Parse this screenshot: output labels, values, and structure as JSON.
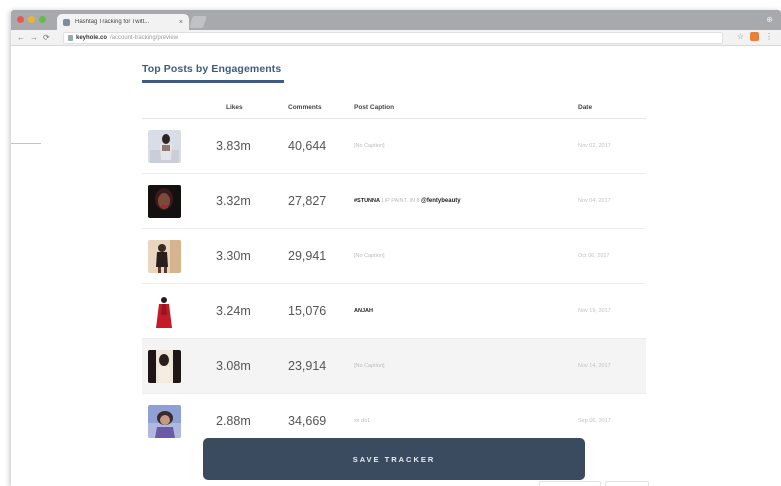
{
  "browser": {
    "tab_title": "Hashtag Tracking for Twitt...",
    "tab_close": "×",
    "url_host": "keyhole.co",
    "url_path": "/account-tracking/preview",
    "nav_back": "←",
    "nav_forward": "→",
    "nav_reload": "⟳",
    "star": "☆",
    "menu": "⋮",
    "profile": "⊕",
    "traffic_light_colors": [
      "#e8584f",
      "#e8b53a",
      "#5fbf4a"
    ]
  },
  "section": {
    "title": "Top Posts by Engagements"
  },
  "table": {
    "columns": [
      "Likes",
      "Comments",
      "Post Caption",
      "Date"
    ],
    "rows": [
      {
        "likes": "3.83m",
        "comments": "40,644",
        "caption": "[No Caption]",
        "date": "Nov 02, 2017",
        "thumb_colors": [
          "#d8dde6",
          "#2a2424"
        ]
      },
      {
        "likes": "3.32m",
        "comments": "27,827",
        "caption_strong": "#STUNNA",
        "caption_soft": " LIP PAINT. IN 8 ",
        "caption_handle": "@fentybeauty",
        "date": "Nov 04, 2017",
        "thumb_colors": [
          "#b4203a",
          "#141010"
        ]
      },
      {
        "likes": "3.30m",
        "comments": "29,941",
        "caption": "[No Caption]",
        "date": "Oct 06, 2017",
        "thumb_colors": [
          "#e9d6c0",
          "#3a2a22"
        ]
      },
      {
        "likes": "3.24m",
        "comments": "15,076",
        "caption_strong": "ANJAH",
        "date": "Nov 19, 2017",
        "thumb_colors": [
          "#ffffff",
          "#c31b28"
        ]
      },
      {
        "likes": "3.08m",
        "comments": "23,914",
        "caption": "[No Caption]",
        "date": "Nov 14, 2017",
        "thumb_colors": [
          "#efe6dc",
          "#1e1616"
        ]
      },
      {
        "likes": "2.88m",
        "comments": "34,669",
        "caption": "xx do1",
        "date": "Sep 06, 2017",
        "thumb_colors": [
          "#8fa0d4",
          "#3a2a2a"
        ]
      }
    ],
    "highlight_row_index": 4
  },
  "actions": {
    "save_tracker_label": "SAVE TRACKER"
  },
  "colors": {
    "accent": "#3f5c80",
    "button_bg": "#3b4b5f"
  }
}
